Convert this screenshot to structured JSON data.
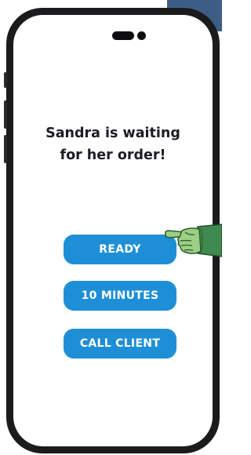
{
  "message": {
    "line1": "Sandra is waiting",
    "line2": "for her order!"
  },
  "actions": {
    "ready_label": "READY",
    "ten_minutes_label": "10 MINUTES",
    "call_client_label": "CALL CLIENT"
  },
  "icons": {
    "pointer": "pointing-hand-icon"
  },
  "colors": {
    "button": "#1e8fd6",
    "button_text": "#ffffff",
    "text": "#1b1d26",
    "phone_frame": "#1b1b1d",
    "sleeve": "#3f8a4e",
    "hand": "#9bcf86"
  }
}
